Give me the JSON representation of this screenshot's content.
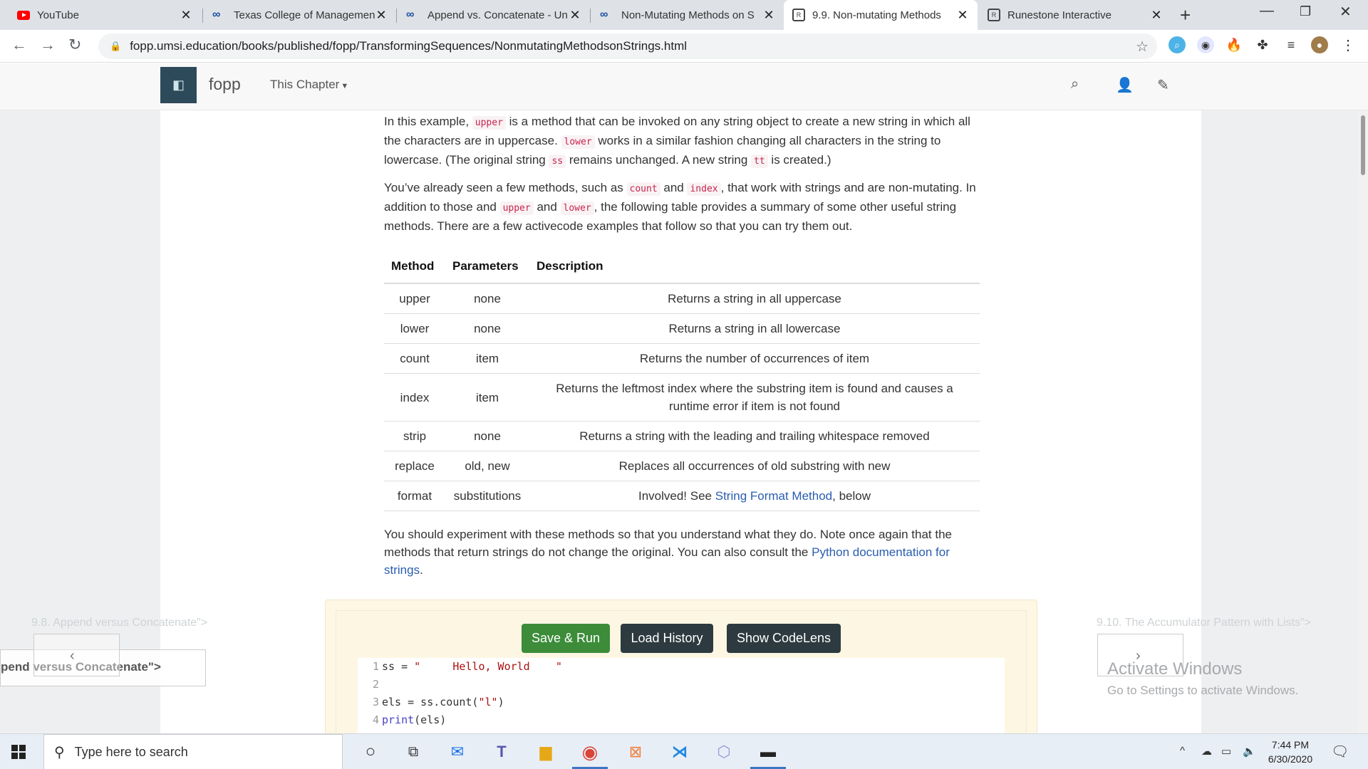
{
  "browser": {
    "tabs": [
      {
        "title": "YouTube",
        "favicon": "youtube-icon"
      },
      {
        "title": "Texas College of Managemen",
        "favicon": "coursera-icon"
      },
      {
        "title": "Append vs. Concatenate - Un",
        "favicon": "coursera-icon"
      },
      {
        "title": "Non-Mutating Methods on S",
        "favicon": "coursera-icon"
      },
      {
        "title": "9.9. Non-mutating Methods",
        "favicon": "runestone-icon"
      },
      {
        "title": "Runestone Interactive",
        "favicon": "runestone-icon"
      }
    ],
    "active_tab": 4,
    "url": "fopp.umsi.education/books/published/fopp/TransformingSequences/NonmutatingMethodsonStrings.html"
  },
  "site": {
    "brand": "fopp",
    "chapter_menu": "This Chapter"
  },
  "content": {
    "para1": {
      "t1": "In this example, ",
      "c1": "upper",
      "t2": " is a method that can be invoked on any string object to create a new string in which all the characters are in uppercase. ",
      "c2": "lower",
      "t3": " works in a similar fashion changing all characters in the string to lowercase. (The original string ",
      "c3": "ss",
      "t4": " remains unchanged. A new string ",
      "c4": "tt",
      "t5": " is created.)"
    },
    "para2": {
      "t1": "You’ve already seen a few methods, such as ",
      "c1": "count",
      "t2": " and ",
      "c2": "index",
      "t3": ", that work with strings and are non-mutating. In addition to those and ",
      "c3": "upper",
      "t4": " and ",
      "c4": "lower",
      "t5": ", the following table provides a summary of some other useful string methods. There are a few activecode examples that follow so that you can try them out."
    },
    "table": {
      "headers": [
        "Method",
        "Parameters",
        "Description"
      ],
      "rows": [
        {
          "method": "upper",
          "params": "none",
          "desc": "Returns a string in all uppercase"
        },
        {
          "method": "lower",
          "params": "none",
          "desc": "Returns a string in all lowercase"
        },
        {
          "method": "count",
          "params": "item",
          "desc": "Returns the number of occurrences of item"
        },
        {
          "method": "index",
          "params": "item",
          "desc": "Returns the leftmost index where the substring item is found and causes a runtime error if item is not found"
        },
        {
          "method": "strip",
          "params": "none",
          "desc": "Returns a string with the leading and trailing whitespace removed"
        },
        {
          "method": "replace",
          "params": "old, new",
          "desc": "Replaces all occurrences of old substring with new"
        },
        {
          "method": "format",
          "params": "substitutions",
          "desc_pre": "Involved! See ",
          "desc_link": "String Format Method",
          "desc_post": ", below"
        }
      ]
    },
    "para3": {
      "t1": "You should experiment with these methods so that you understand what they do. Note once again that the methods that return strings do not change the original. You can also consult the ",
      "link": "Python documentation for strings",
      "t2": "."
    }
  },
  "activecode": {
    "save_run": "Save & Run",
    "load_history": "Load History",
    "show_codelens": "Show CodeLens",
    "lines": [
      {
        "num": "1",
        "a": "ss = ",
        "s": "\"     Hello, World    \"",
        "b": ""
      },
      {
        "num": "2",
        "a": "",
        "s": "",
        "b": ""
      },
      {
        "num": "3",
        "a": "els = ss.count(",
        "s": "\"l\"",
        "b": ")"
      },
      {
        "num": "4",
        "kw": "print",
        "a": "(els)",
        "s": "",
        "b": ""
      }
    ]
  },
  "navigation": {
    "prev_hint": "9.8. Append versus Concatenate\">",
    "prev_box": "pend versus Concatenate\">",
    "next_hint": "9.10. The Accumulator Pattern with Lists\">"
  },
  "watermark": {
    "line1": "Activate Windows",
    "line2": "Go to Settings to activate Windows."
  },
  "taskbar": {
    "search_placeholder": "Type here to search",
    "time": "7:44 PM",
    "date": "6/30/2020"
  },
  "colors": {
    "code_text": "#c7254e",
    "link": "#2a5db0",
    "save_button": "#3c8c3a",
    "dark_button": "#2d3a40"
  }
}
